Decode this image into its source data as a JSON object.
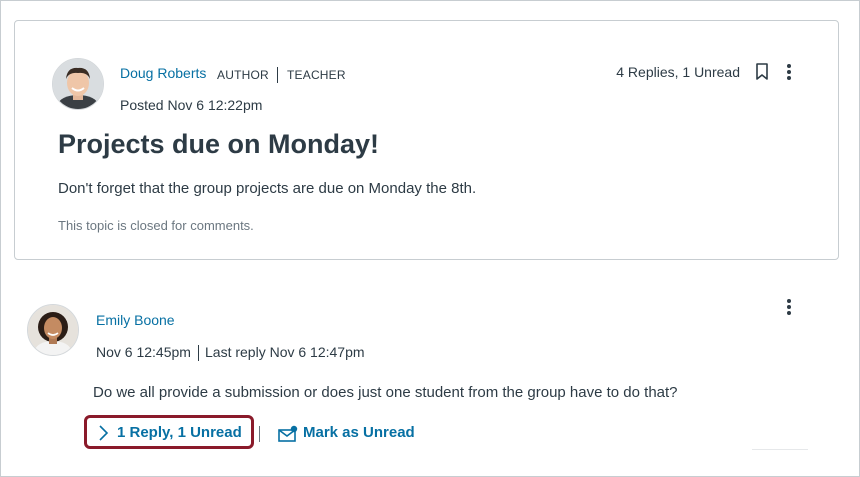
{
  "topic": {
    "author_name": "Doug Roberts",
    "role_author": "AUTHOR",
    "role_teacher": "TEACHER",
    "posted": "Posted Nov 6 12:22pm",
    "replies_summary": "4 Replies, 1 Unread",
    "title": "Projects due on Monday!",
    "message": "Don't forget that the group projects are due on Monday the 8th.",
    "closed_note": "This topic is closed for comments.",
    "icons": {
      "bookmark": "bookmark-icon",
      "more": "more-options-icon",
      "avatar": "avatar"
    }
  },
  "reply": {
    "author_name": "Emily Boone",
    "timestamp": "Nov 6 12:45pm",
    "last_reply": "Last reply Nov 6 12:47pm",
    "message": "Do we all provide a submission or does just one student from the group have to do that?",
    "expand_label": "1 Reply, 1 Unread",
    "mark_unread_label": "Mark as Unread",
    "icons": {
      "expand": "chevron-right-icon",
      "mark_unread": "mail-unread-icon",
      "more": "more-options-icon"
    }
  },
  "colors": {
    "link": "#0770a3",
    "text": "#2d3b45",
    "highlight": "#8a1a2a",
    "muted": "#6b7780"
  }
}
